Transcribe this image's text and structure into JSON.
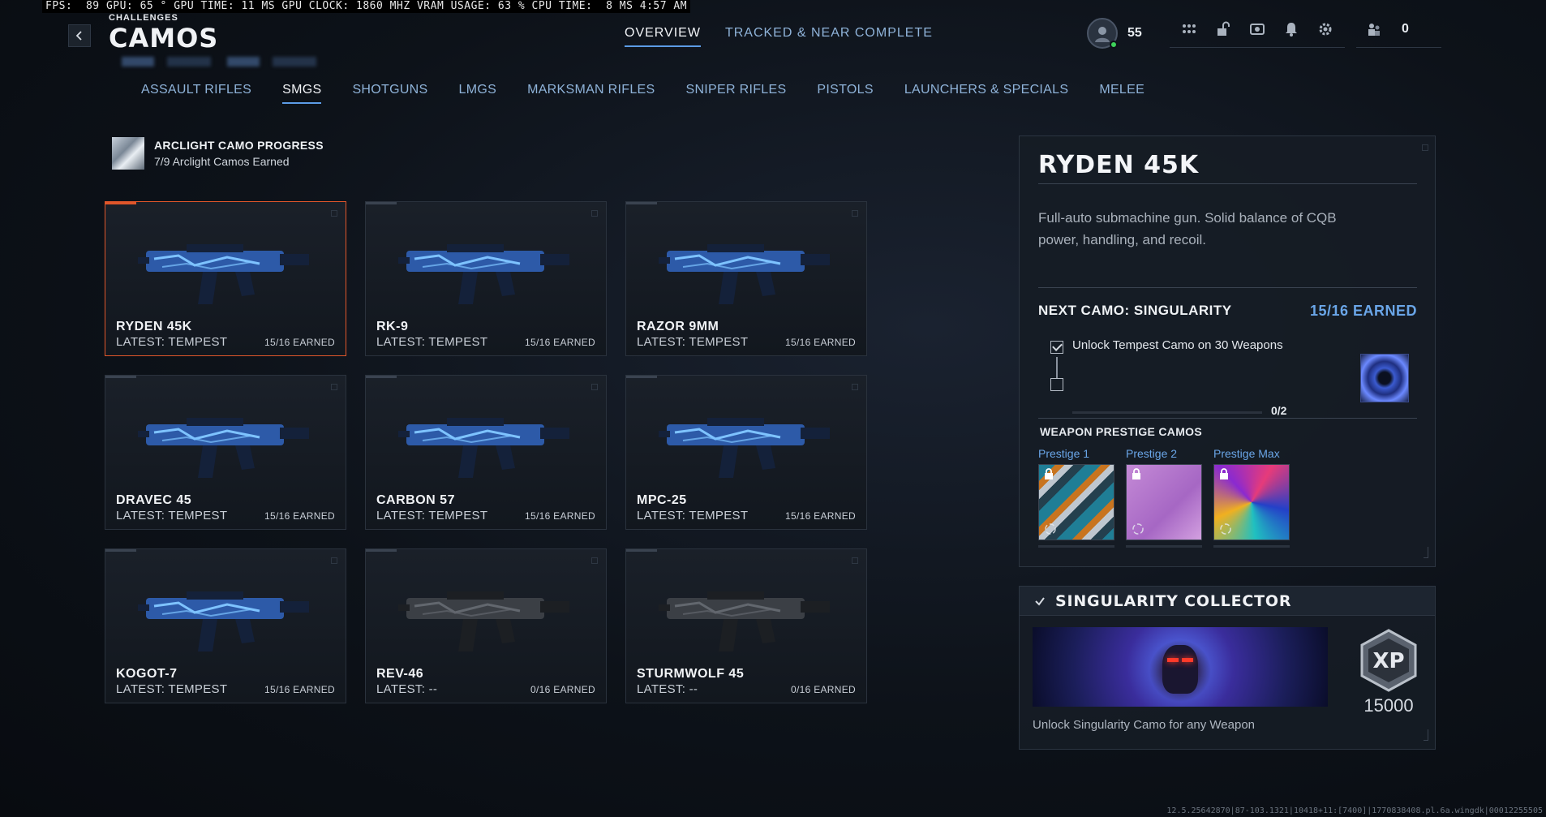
{
  "perf_overlay": "FPS:  89 GPU: 65 ° GPU TIME: 11 MS GPU CLOCK: 1860 MHZ VRAM USAGE: 63 % CPU TIME:  8 MS 4:57 AM",
  "header": {
    "subtitle": "CHALLENGES",
    "title": "CAMOS",
    "tabs": [
      {
        "label": "OVERVIEW",
        "active": true
      },
      {
        "label": "TRACKED & NEAR COMPLETE",
        "active": false
      }
    ],
    "player_level": "55",
    "currency_count": "0"
  },
  "categories": [
    {
      "label": "ASSAULT RIFLES",
      "active": false
    },
    {
      "label": "SMGS",
      "active": true
    },
    {
      "label": "SHOTGUNS",
      "active": false
    },
    {
      "label": "LMGS",
      "active": false
    },
    {
      "label": "MARKSMAN RIFLES",
      "active": false
    },
    {
      "label": "SNIPER RIFLES",
      "active": false
    },
    {
      "label": "PISTOLS",
      "active": false
    },
    {
      "label": "LAUNCHERS & SPECIALS",
      "active": false
    },
    {
      "label": "MELEE",
      "active": false
    }
  ],
  "arclight": {
    "title": "ARCLIGHT CAMO PROGRESS",
    "subtitle": "7/9 Arclight Camos Earned"
  },
  "weapons": [
    {
      "name": "RYDEN 45K",
      "latest": "LATEST: TEMPEST",
      "earned": "15/16 EARNED",
      "camo": "blue"
    },
    {
      "name": "RK-9",
      "latest": "LATEST: TEMPEST",
      "earned": "15/16 EARNED",
      "camo": "blue"
    },
    {
      "name": "RAZOR 9MM",
      "latest": "LATEST: TEMPEST",
      "earned": "15/16 EARNED",
      "camo": "blue"
    },
    {
      "name": "DRAVEC 45",
      "latest": "LATEST: TEMPEST",
      "earned": "15/16 EARNED",
      "camo": "blue"
    },
    {
      "name": "CARBON 57",
      "latest": "LATEST: TEMPEST",
      "earned": "15/16 EARNED",
      "camo": "blue"
    },
    {
      "name": "MPC-25",
      "latest": "LATEST: TEMPEST",
      "earned": "15/16 EARNED",
      "camo": "blue"
    },
    {
      "name": "KOGOT-7",
      "latest": "LATEST: TEMPEST",
      "earned": "15/16 EARNED",
      "camo": "blue"
    },
    {
      "name": "REV-46",
      "latest": "LATEST: --",
      "earned": "0/16 EARNED",
      "camo": "none"
    },
    {
      "name": "STURMWOLF 45",
      "latest": "LATEST: --",
      "earned": "0/16 EARNED",
      "camo": "none"
    }
  ],
  "detail": {
    "title": "RYDEN 45K",
    "description": "Full-auto submachine gun. Solid balance of CQB power, handling, and recoil.",
    "next_camo_label": "NEXT CAMO: SINGULARITY",
    "next_camo_earned": "15/16 EARNED",
    "challenge": "Unlock Tempest Camo on 30 Weapons",
    "progress_text": "0/2",
    "prestige_title": "WEAPON PRESTIGE CAMOS",
    "prestige": [
      {
        "label": "Prestige 1"
      },
      {
        "label": "Prestige 2"
      },
      {
        "label": "Prestige Max"
      }
    ]
  },
  "collector": {
    "title": "SINGULARITY COLLECTOR",
    "xp_badge": "XP",
    "xp_amount": "15000",
    "unlock_text": "Unlock Singularity Camo for any Weapon"
  },
  "build_string": "12.5.25642870|87-103.1321|10418+11:[7400]|1770838408.pl.6a.wingdk|00012255505"
}
